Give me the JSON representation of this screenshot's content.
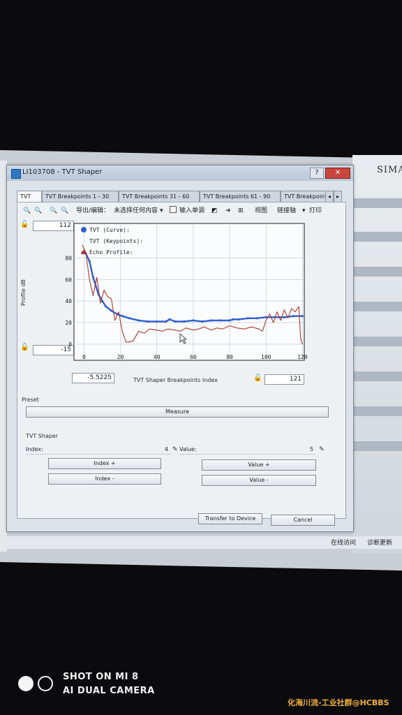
{
  "window": {
    "title": "LI103708 - TVT Shaper",
    "help_label": "?",
    "close_label": "✕"
  },
  "siemens_logo": "SIMAT",
  "tabs": [
    "TVT",
    "TVT Breakpoints 1 - 30",
    "TVT Breakpoints 31 - 60",
    "TVT Breakpoints 61 - 90",
    "TVT Breakpoints"
  ],
  "toolbar": {
    "export_label": "导出/编辑：",
    "select_label": "未选择任何内容",
    "single_input_label": "输入单调",
    "view_label": "视图",
    "link_axis_label": "链接轴",
    "print_label": "打印"
  },
  "chart_inputs": {
    "y_max": "112",
    "y_min": "-15",
    "x_min": "-5.5225",
    "x_max": "121"
  },
  "chart_data": {
    "type": "line",
    "xlabel": "TVT Shaper Breakpoints  Index",
    "ylabel": "Profile  dB",
    "xlim": [
      -5.5225,
      121
    ],
    "ylim": [
      -15,
      112
    ],
    "x_ticks": [
      "0",
      "20",
      "40",
      "60",
      "80",
      "100",
      "120"
    ],
    "y_ticks": [
      "0",
      "20",
      "40",
      "60",
      "80"
    ],
    "grid": true,
    "legend_position": "top-left",
    "series": [
      {
        "name": "TVT (Curve)",
        "color": "#2f5fd0",
        "x": [
          -1,
          1,
          3,
          5,
          8,
          10,
          12,
          15,
          18,
          21,
          25,
          30,
          35,
          40,
          45,
          47,
          50,
          55,
          60,
          65,
          70,
          75,
          80,
          82,
          85,
          90,
          95,
          100,
          105,
          110,
          115,
          120
        ],
        "y": [
          85,
          84,
          77,
          62,
          46,
          40,
          35,
          31,
          28,
          26,
          24,
          22,
          21,
          21,
          21,
          23,
          21,
          21,
          22,
          21,
          22,
          22,
          22,
          23,
          23,
          24,
          24,
          25,
          25,
          25,
          26,
          26
        ]
      },
      {
        "name": "TVT (Keypoints)",
        "color": "#2f5fd0",
        "x": [],
        "y": []
      },
      {
        "name": "Echo Profile",
        "color": "#a83a2a",
        "x": [
          -1,
          1,
          3,
          5,
          7,
          9,
          11,
          13,
          15,
          17,
          19,
          21,
          23,
          25,
          27,
          30,
          33,
          36,
          40,
          43,
          46,
          50,
          53,
          56,
          60,
          63,
          66,
          70,
          73,
          76,
          80,
          84,
          88,
          92,
          96,
          98,
          100,
          102,
          104,
          106,
          108,
          110,
          112,
          114,
          116,
          118,
          119,
          120
        ],
        "y": [
          92,
          85,
          60,
          45,
          62,
          38,
          50,
          44,
          42,
          22,
          30,
          12,
          2,
          2,
          3,
          12,
          10,
          14,
          13,
          12,
          14,
          13,
          12,
          15,
          13,
          14,
          16,
          13,
          15,
          14,
          17,
          15,
          14,
          16,
          14,
          12,
          22,
          28,
          20,
          30,
          22,
          32,
          24,
          33,
          30,
          35,
          5,
          0
        ]
      }
    ]
  },
  "preset": {
    "section_label": "Preset",
    "measure_label": "Measure"
  },
  "shaper": {
    "section_label": "TVT Shaper",
    "index_label": "Index:",
    "index_value": "4",
    "value_label": "Value:",
    "value_value": "5",
    "index_plus": "Index +",
    "index_minus": "Index -",
    "value_plus": "Value +",
    "value_minus": "Value -"
  },
  "footer": {
    "transfer_label": "Transfer to Device",
    "cancel_label": "Cancel"
  },
  "statusbar": {
    "online_label": "在线访问",
    "diag_label": "诊断更新"
  },
  "camera": {
    "line1": "SHOT ON MI 8",
    "line2": "AI DUAL CAMERA"
  },
  "watermark": "化海川流-工业社群@HCBBS",
  "colors": {
    "accent": "#2f5fd0",
    "echo": "#a83a2a",
    "close": "#c9453d"
  }
}
